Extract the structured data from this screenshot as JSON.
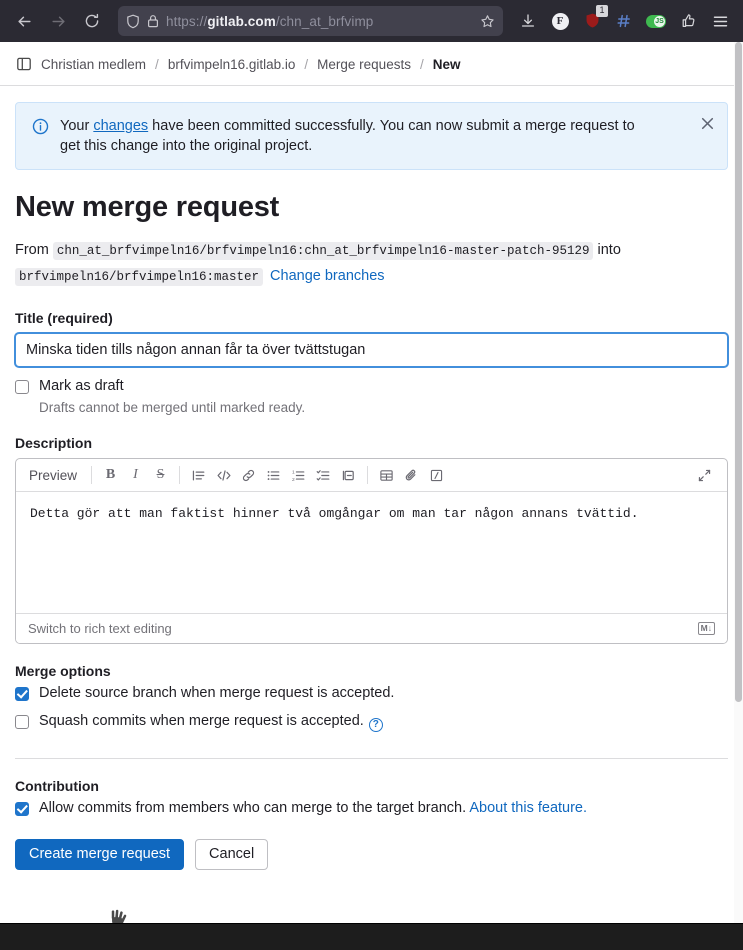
{
  "browser": {
    "nav": {
      "back_icon": "arrow-left-icon",
      "forward_icon": "arrow-right-icon",
      "reload_icon": "reload-icon"
    },
    "urlbar": {
      "shield_icon": "shield-icon",
      "lock_icon": "lock-icon",
      "url_prefix": "https://",
      "url_domain": "gitlab.com",
      "url_path": "/chn_at_brfvimp",
      "bookmark_icon": "star-icon"
    },
    "extensions": [
      {
        "name": "downloads-icon",
        "label": ""
      },
      {
        "name": "facebook-container-icon",
        "label": "F"
      },
      {
        "name": "ublock-origin-icon",
        "label": "",
        "badge": "1"
      },
      {
        "name": "hashtag-extension-icon",
        "label": "#"
      },
      {
        "name": "javascript-toggle-icon",
        "label": "JS"
      },
      {
        "name": "thumbs-up-extension-icon",
        "label": ""
      }
    ],
    "menu_icon": "hamburger-menu-icon"
  },
  "breadcrumb": {
    "sidebar_toggle_icon": "sidebar-toggle-icon",
    "items": [
      {
        "label": "Christian medlem",
        "current": false
      },
      {
        "label": "brfvimpeln16.gitlab.io",
        "current": false
      },
      {
        "label": "Merge requests",
        "current": false
      },
      {
        "label": "New",
        "current": true
      }
    ],
    "separator": "/"
  },
  "alert": {
    "icon": "info-icon",
    "text_before": "Your ",
    "link_text": "changes",
    "text_after": " have been committed successfully. You can now submit a merge request to get this change into the original project.",
    "close_icon": "close-icon",
    "bg_color": "#e9f3fc",
    "accent_color": "#1f75cb"
  },
  "page": {
    "title": "New merge request",
    "branch": {
      "from_label": "From",
      "source_branch": "chn_at_brfvimpeln16/brfvimpeln16:chn_at_brfvimpeln16-master-patch-95129",
      "into_label": "into",
      "target_branch": "brfvimpeln16/brfvimpeln16:master",
      "change_branches_link": "Change branches"
    },
    "title_field": {
      "label": "Title (required)",
      "value": "Minska tiden tills någon annan får ta över tvättstugan",
      "placeholder": ""
    },
    "draft": {
      "label": "Mark as draft",
      "checked": false,
      "note": "Drafts cannot be merged until marked ready."
    },
    "description": {
      "label": "Description",
      "toolbar": {
        "preview_label": "Preview",
        "buttons": [
          {
            "name": "bold-icon",
            "glyph": "B"
          },
          {
            "name": "italic-icon",
            "glyph": "I"
          },
          {
            "name": "strikethrough-icon",
            "glyph": "S"
          },
          {
            "name": "blockquote-icon",
            "glyph": ""
          },
          {
            "name": "code-icon",
            "glyph": "</>"
          },
          {
            "name": "link-icon",
            "glyph": ""
          },
          {
            "name": "bullet-list-icon",
            "glyph": ""
          },
          {
            "name": "numbered-list-icon",
            "glyph": ""
          },
          {
            "name": "task-list-icon",
            "glyph": ""
          },
          {
            "name": "collapsible-section-icon",
            "glyph": ""
          },
          {
            "name": "table-icon",
            "glyph": ""
          },
          {
            "name": "attach-file-icon",
            "glyph": ""
          },
          {
            "name": "insert-comment-template-icon",
            "glyph": "/"
          }
        ],
        "expand_icon": "expand-icon"
      },
      "value": "Detta gör att man faktist hinner två omgångar om man tar någon annans tvättid.",
      "footer": {
        "switch_link": "Switch to rich text editing",
        "markdown_icon": "markdown-icon",
        "markdown_glyph": "M↓"
      }
    },
    "merge_options": {
      "heading": "Merge options",
      "items": [
        {
          "label": "Delete source branch when merge request is accepted.",
          "checked": true,
          "help": false
        },
        {
          "label": "Squash commits when merge request is accepted.",
          "checked": false,
          "help": true,
          "help_icon": "help-icon"
        }
      ]
    },
    "contribution": {
      "heading": "Contribution",
      "checkbox_label": "Allow commits from members who can merge to the target branch.",
      "checked": true,
      "link_text": "About this feature."
    },
    "actions": {
      "primary": "Create merge request",
      "secondary": "Cancel",
      "primary_color": "#1068bf"
    }
  },
  "cursor": {
    "name": "hand-pointer-cursor"
  }
}
